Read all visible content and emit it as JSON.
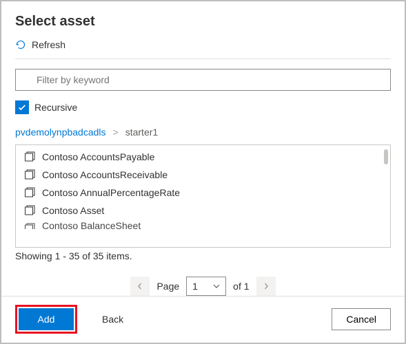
{
  "dialog": {
    "title": "Select asset"
  },
  "toolbar": {
    "refresh_label": "Refresh"
  },
  "filter": {
    "placeholder": "Filter by keyword",
    "value": ""
  },
  "recursive": {
    "label": "Recursive",
    "checked": true
  },
  "breadcrumb": {
    "root": "pvdemolynpbadcadls",
    "separator": ">",
    "current": "starter1"
  },
  "assets": [
    {
      "name": "Contoso AccountsPayable"
    },
    {
      "name": "Contoso AccountsReceivable"
    },
    {
      "name": "Contoso AnnualPercentageRate"
    },
    {
      "name": "Contoso Asset"
    },
    {
      "name": "Contoso BalanceSheet"
    }
  ],
  "status": {
    "text": "Showing 1 - 35 of 35 items."
  },
  "pager": {
    "page_label": "Page",
    "current_page": "1",
    "of_label": "of 1"
  },
  "footer": {
    "add_label": "Add",
    "back_label": "Back",
    "cancel_label": "Cancel"
  }
}
